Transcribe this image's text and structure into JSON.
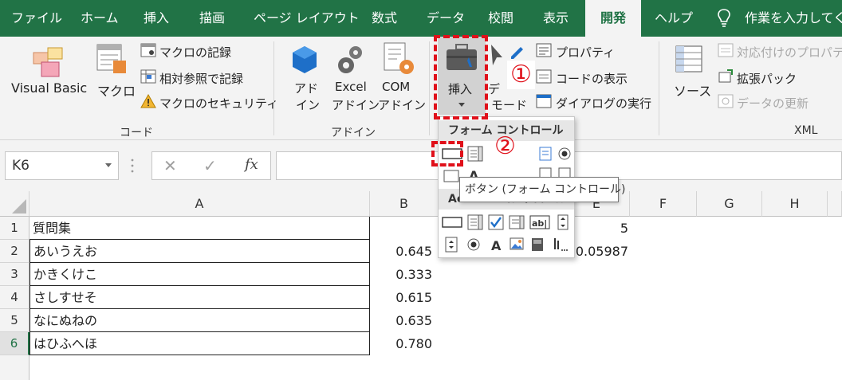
{
  "tabs": [
    "ファイル",
    "ホーム",
    "挿入",
    "描画",
    "ページ レイアウト",
    "数式",
    "データ",
    "校閲",
    "表示",
    "開発",
    "ヘルプ"
  ],
  "tell_me": "作業を入力してくだ",
  "ribbon": {
    "code": {
      "visual_basic": "Visual Basic",
      "macro": "マクロ",
      "record_macro": "マクロの記録",
      "relative_ref": "相対参照で記録",
      "macro_security": "マクロのセキュリティ",
      "group_label": "コード"
    },
    "addins": {
      "addin_1": "アド",
      "addin_2": "イン",
      "excel_1": "Excel",
      "excel_2": "アドイン",
      "com_1": "COM",
      "com_2": "アドイン",
      "group_label": "アドイン"
    },
    "controls": {
      "insert": "挿入",
      "design_1": "デ",
      "design_2": "モード",
      "properties": "プロパティ",
      "view_code": "コードの表示",
      "run_dialog": "ダイアログの実行"
    },
    "xml": {
      "source": "ソース",
      "map_props": "対応付けのプロパティ",
      "expansion": "拡張パック",
      "refresh": "データの更新",
      "group_label": "XML"
    }
  },
  "formula_bar": {
    "name_box": "K6",
    "fx": "fx",
    "cancel": "✕",
    "enter": "✓"
  },
  "columns": [
    "A",
    "B",
    "E",
    "F",
    "G",
    "H"
  ],
  "rows": [
    {
      "num": "1",
      "a": "質問集",
      "b": "",
      "e": "5"
    },
    {
      "num": "2",
      "a": "あいうえお",
      "b": "0.645",
      "e": "0.05987"
    },
    {
      "num": "3",
      "a": "かきくけこ",
      "b": "0.333",
      "e": ""
    },
    {
      "num": "4",
      "a": "さしすせそ",
      "b": "0.615",
      "e": ""
    },
    {
      "num": "5",
      "a": "なにぬねの",
      "b": "0.635",
      "e": ""
    },
    {
      "num": "6",
      "a": "はひふへほ",
      "b": "0.780",
      "e": ""
    }
  ],
  "dropdown": {
    "form_controls": "フォーム コントロール",
    "activex_controls": "ActiveX コントロール",
    "tooltip": "ボタン (フォーム コントロール)"
  },
  "callouts": [
    "①",
    "②"
  ],
  "colors": {
    "excel_green": "#217346",
    "annotation_red": "#e0101a"
  }
}
